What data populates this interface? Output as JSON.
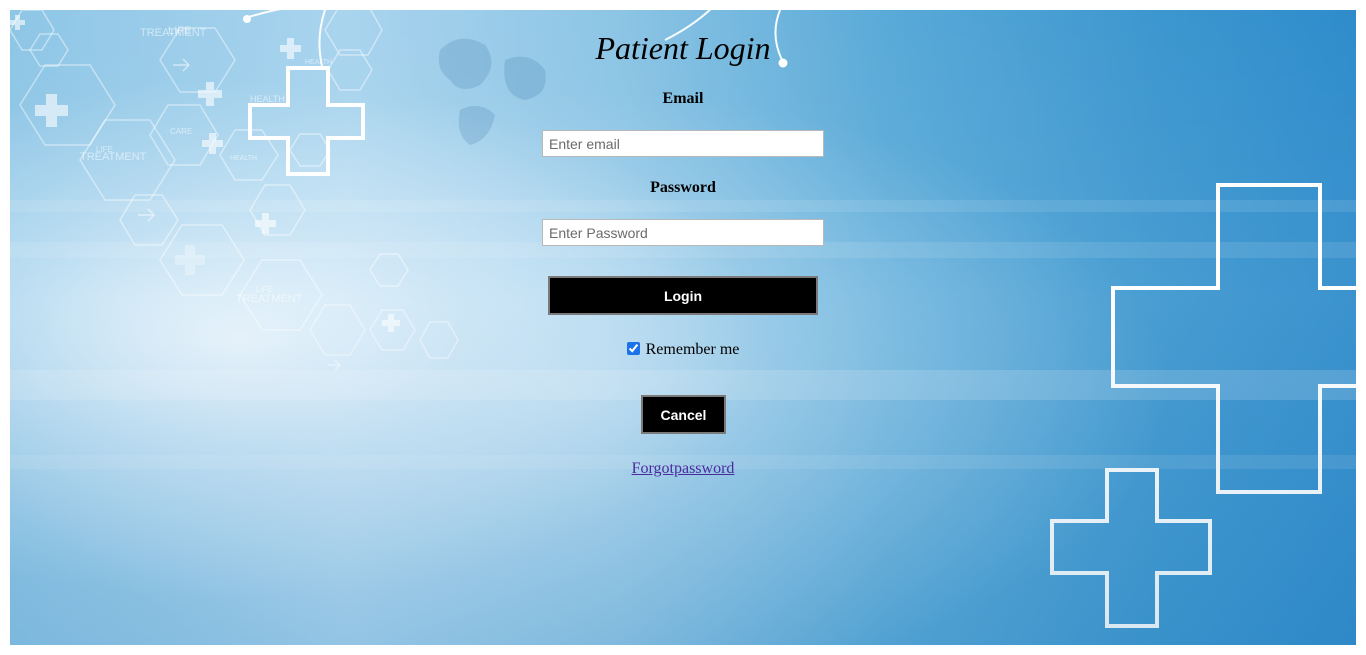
{
  "page": {
    "title": "Patient Login"
  },
  "form": {
    "email_label": "Email",
    "email_placeholder": "Enter email",
    "email_value": "",
    "password_label": "Password",
    "password_placeholder": "Enter Password",
    "password_value": "",
    "login_label": "Login",
    "remember_label": "Remember me",
    "remember_checked": true,
    "cancel_label": "Cancel",
    "forgot_label": "Forgotpassword"
  },
  "background": {
    "decor_icons": [
      "medical-cross-icon",
      "hexagon-pattern",
      "world-map"
    ],
    "hex_texts": [
      "LIFE",
      "TREATMENT",
      "HEALTH",
      "CARE",
      "HEALTH",
      "LIFE",
      "TREATMENT",
      "HEALTH",
      "LIFE",
      "TREATMENT"
    ],
    "colors": {
      "sky_light": "#a9d4ee",
      "sky_dark": "#2f8ccb",
      "button": "#000000",
      "link": "#4b2a9e",
      "checkbox": "#1a73e8"
    }
  }
}
